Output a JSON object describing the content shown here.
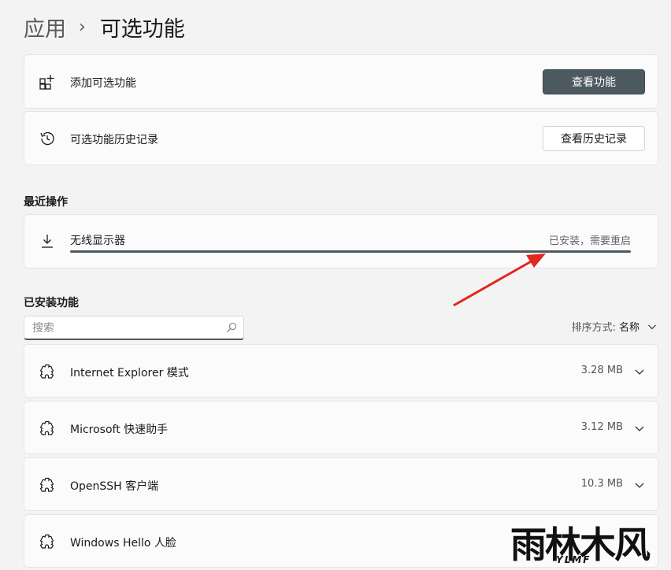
{
  "breadcrumb": {
    "parent": "应用",
    "current": "可选功能"
  },
  "add_feature": {
    "label": "添加可选功能",
    "button": "查看功能"
  },
  "history": {
    "label": "可选功能历史记录",
    "button": "查看历史记录"
  },
  "recent": {
    "title": "最近操作",
    "item": {
      "name": "无线显示器",
      "status": "已安装，需要重启",
      "progress": 1.0
    }
  },
  "installed": {
    "title": "已安装功能",
    "search_placeholder": "搜索",
    "sort_label": "排序方式:",
    "sort_value": "名称",
    "items": [
      {
        "name": "Internet Explorer 模式",
        "size": "3.28 MB"
      },
      {
        "name": "Microsoft 快速助手",
        "size": "3.12 MB"
      },
      {
        "name": "OpenSSH 客户端",
        "size": "10.3 MB"
      },
      {
        "name": "Windows Hello 人脸",
        "size": ""
      }
    ]
  },
  "watermark": {
    "main": "雨林木风",
    "sub": "YLMF"
  },
  "colors": {
    "accent": "#4d5961",
    "arrow": "#e0281e"
  }
}
